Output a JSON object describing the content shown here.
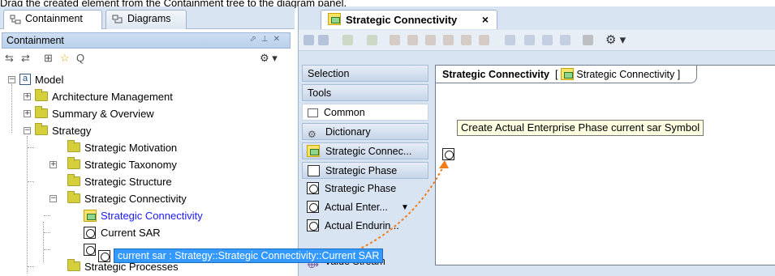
{
  "caption": "Drag the created element from the Containment tree to the diagram panel.",
  "left_tabs": [
    {
      "label": "Containment"
    },
    {
      "label": "Diagrams"
    }
  ],
  "containment": {
    "title": "Containment",
    "tree": [
      {
        "label": "Model"
      },
      {
        "label": "Architecture Management"
      },
      {
        "label": "Summary & Overview"
      },
      {
        "label": "Strategy"
      },
      {
        "label": "Strategic Motivation"
      },
      {
        "label": "Strategic Taxonomy"
      },
      {
        "label": "Strategic Structure"
      },
      {
        "label": "Strategic Connectivity"
      },
      {
        "label": "Strategic Connectivity"
      },
      {
        "label": "Current SAR"
      },
      {
        "label": "current sar : Strategy::Strategic Connectivity::Current SAR"
      },
      {
        "label": "Strategic Processes"
      }
    ]
  },
  "diagram": {
    "tab_label": "Strategic Connectivity",
    "close": "×",
    "frame_title": "Strategic Connectivity",
    "frame_ref": "Strategic Connectivity"
  },
  "palette": [
    {
      "label": "Selection"
    },
    {
      "label": "Tools"
    },
    {
      "label": "Common"
    },
    {
      "label": "Dictionary"
    },
    {
      "label": "Strategic Connec..."
    },
    {
      "label": "Strategic Phase"
    },
    {
      "label": "Strategic Phase"
    },
    {
      "label": "Actual Enter..."
    },
    {
      "label": "Actual Endurin..."
    },
    {
      "label": "Value Stream"
    }
  ],
  "tooltip": "Create Actual Enterprise Phase current sar Symbol",
  "colors": {
    "selection": "#3399ff",
    "link": "#1a1aff",
    "drag_arrow": "#f07d1a"
  }
}
